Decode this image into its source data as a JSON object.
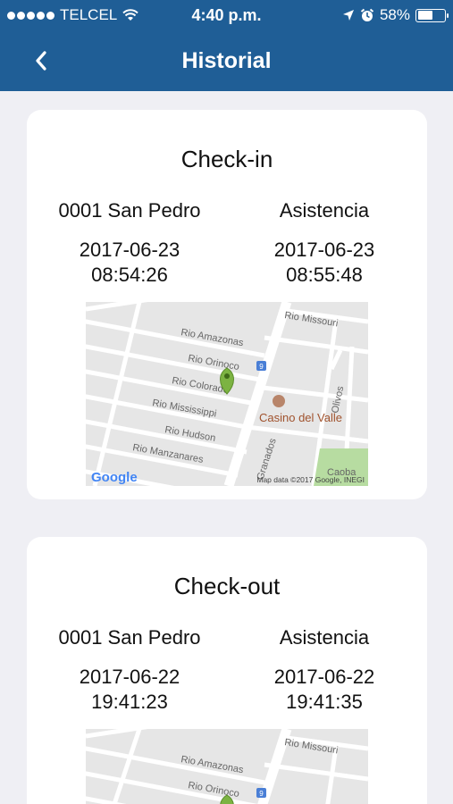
{
  "status_bar": {
    "carrier": "TELCEL",
    "time": "4:40 p.m.",
    "battery_percent": "58%",
    "battery_level": 0.58,
    "icons": [
      "signal-dots-icon",
      "wifi-icon",
      "location-arrow-icon",
      "alarm-icon",
      "battery-icon"
    ]
  },
  "nav": {
    "title": "Historial",
    "back_icon": "chevron-left-icon"
  },
  "records": [
    {
      "title": "Check-in",
      "location": "0001 San Pedro",
      "type": "Asistencia",
      "date_1": "2017-06-23",
      "time_1": "08:54:26",
      "date_2": "2017-06-23",
      "time_2": "08:55:48",
      "map": {
        "streets": [
          "Rio Missouri",
          "Rio Amazonas",
          "Rio Orinoco",
          "Rio Colorado",
          "Rio Mississippi",
          "Rio Hudson",
          "Rio Manzanares",
          "Granados",
          "Olivos",
          "Caoba"
        ],
        "place": "Casino del Valle",
        "attribution": "Map data ©2017 Google, INEGI",
        "logo": "Google",
        "pin_color": "#7cb342"
      }
    },
    {
      "title": "Check-out",
      "location": "0001 San Pedro",
      "type": "Asistencia",
      "date_1": "2017-06-22",
      "time_1": "19:41:23",
      "date_2": "2017-06-22",
      "time_2": "19:41:35",
      "map": {
        "streets": [
          "Rio Missouri",
          "Rio Amazonas",
          "Rio Orinoco"
        ]
      }
    }
  ],
  "colors": {
    "header": "#1f5e96",
    "background": "#efeff4",
    "card": "#ffffff"
  }
}
